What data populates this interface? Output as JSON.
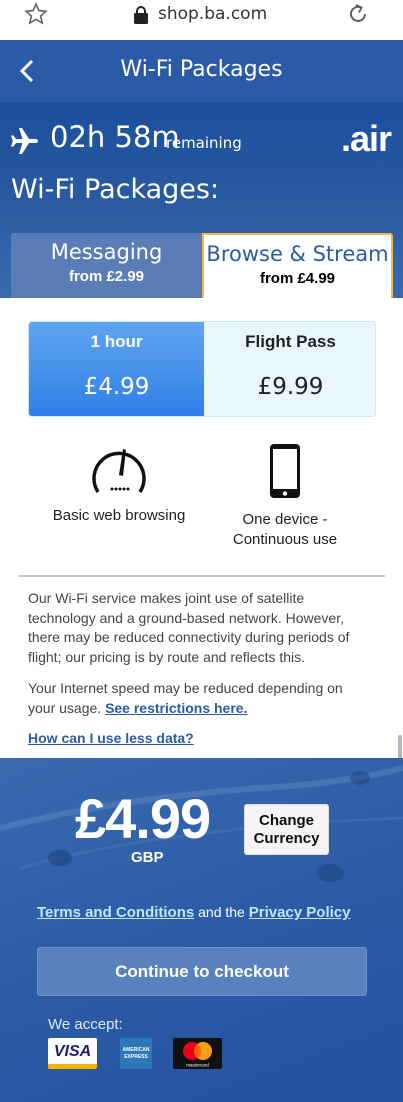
{
  "browser": {
    "url": "shop.ba.com"
  },
  "header": {
    "title": "Wi-Fi Packages"
  },
  "hero": {
    "time": "02h 58m",
    "remaining": "remaining",
    "brand": ".air",
    "heading": "Wi-Fi Packages:"
  },
  "tabs": [
    {
      "name": "Messaging",
      "price": "from £2.99"
    },
    {
      "name": "Browse & Stream",
      "price": "from £4.99"
    }
  ],
  "options": [
    {
      "name": "1 hour",
      "price": "£4.99"
    },
    {
      "name": "Flight Pass",
      "price": "£9.99"
    }
  ],
  "features": {
    "speed": "Basic web browsing",
    "device_line1": "One device -",
    "device_line2": "Continuous use"
  },
  "info": {
    "paragraph1": "Our Wi-Fi service makes joint use of satellite technology and a ground-based network. However, there may be reduced connectivity during periods of flight; our pricing is by route and reflects this.",
    "paragraph2": "Your Internet speed may be reduced depending on your usage.",
    "restrictions_link": "See restrictions here.",
    "less_data_link": "How can I use less data?"
  },
  "checkout": {
    "price": "£4.99",
    "currency": "GBP",
    "change_currency_line1": "Change",
    "change_currency_line2": "Currency",
    "terms_link": "Terms and Conditions",
    "and_the": "and the",
    "privacy_link": "Privacy Policy",
    "continue": "Continue to checkout",
    "accept": "We accept:",
    "cards": {
      "visa": "VISA",
      "amex_line1": "AMERICAN",
      "amex_line2": "EXPRESS",
      "mastercard": "mastercard"
    }
  },
  "colors": {
    "brand_blue": "#2b5ba6",
    "selected_tab_border": "#f0b74a",
    "selected_option": "#2f7ee8"
  }
}
